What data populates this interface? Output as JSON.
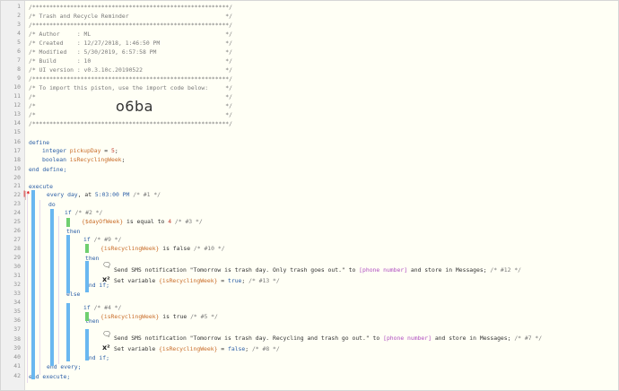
{
  "lines": [
    {
      "n": "1",
      "t": "/*********************************************************/",
      "c": "cmt"
    },
    {
      "n": "2",
      "t": "/* Trash and Recycle Reminder                            */",
      "c": "cmt"
    },
    {
      "n": "3",
      "t": "/*********************************************************/",
      "c": "cmt"
    },
    {
      "n": "4",
      "t": "/* Author     : ML                                       */",
      "c": "cmt"
    },
    {
      "n": "5",
      "t": "/* Created    : 12/27/2018, 1:46:50 PM                   */",
      "c": "cmt"
    },
    {
      "n": "6",
      "t": "/* Modified   : 5/30/2019, 6:57:58 PM                    */",
      "c": "cmt"
    },
    {
      "n": "7",
      "t": "/* Build      : 10                                       */",
      "c": "cmt"
    },
    {
      "n": "8",
      "t": "/* UI version : v0.3.10c.20190522                        */",
      "c": "cmt"
    },
    {
      "n": "9",
      "t": "/*********************************************************/",
      "c": "cmt"
    },
    {
      "n": "10",
      "t": "/* To import this piston, use the import code below:     */",
      "c": "cmt"
    },
    {
      "n": "11",
      "t": "/*                                                       */",
      "c": "cmt"
    },
    {
      "n": "12",
      "t": "/*                                                       */",
      "c": "cmt"
    },
    {
      "n": "13",
      "t": "/*                                                       */",
      "c": "cmt"
    },
    {
      "n": "14",
      "t": "/*********************************************************/",
      "c": "cmt"
    },
    {
      "n": "15",
      "t": "",
      "c": ""
    },
    {
      "n": "16",
      "t": "define",
      "c": "kw"
    },
    {
      "n": "17",
      "t": "",
      "c": ""
    },
    {
      "n": "18",
      "t": "",
      "c": ""
    },
    {
      "n": "19",
      "t": "end define;",
      "c": "kw"
    },
    {
      "n": "20",
      "t": "",
      "c": ""
    },
    {
      "n": "21",
      "t": "execute",
      "c": "kw"
    },
    {
      "n": "22",
      "t": "",
      "c": ""
    },
    {
      "n": "23",
      "t": "do",
      "c": "kw"
    },
    {
      "n": "24",
      "t": "",
      "c": ""
    },
    {
      "n": "25",
      "t": "",
      "c": ""
    },
    {
      "n": "26",
      "t": "then",
      "c": "kw"
    },
    {
      "n": "27",
      "t": "",
      "c": ""
    },
    {
      "n": "28",
      "t": "",
      "c": ""
    },
    {
      "n": "29",
      "t": "then",
      "c": "kw"
    },
    {
      "n": "30",
      "t": "",
      "c": ""
    },
    {
      "n": "31",
      "t": "",
      "c": ""
    },
    {
      "n": "32",
      "t": "end if;",
      "c": "kw"
    },
    {
      "n": "33",
      "t": "else",
      "c": "kw"
    },
    {
      "n": "34",
      "t": "",
      "c": ""
    },
    {
      "n": "35",
      "t": "",
      "c": ""
    },
    {
      "n": "36",
      "t": "then",
      "c": "kw"
    },
    {
      "n": "37",
      "t": "",
      "c": ""
    },
    {
      "n": "38",
      "t": "",
      "c": ""
    },
    {
      "n": "39",
      "t": "",
      "c": ""
    },
    {
      "n": "40",
      "t": "end if;",
      "c": "kw"
    },
    {
      "n": "41",
      "t": "end every;",
      "c": "kw"
    },
    {
      "n": "42",
      "t": "end execute;",
      "c": "kw"
    }
  ],
  "import_code": "o6ba",
  "define": {
    "l17": {
      "type": "integer",
      "name": "pickupDay",
      "eq": " = ",
      "val": "5",
      "end": ";"
    },
    "l18": {
      "type": "boolean",
      "name": "isRecyclingWeek",
      "end": ";"
    }
  },
  "every": {
    "kw": "every",
    "day": "day",
    "at": ", at ",
    "time": "5:03:00 PM",
    "cmt": "/* #1 */"
  },
  "if1": {
    "kw": "if",
    "cmt": "/* #2 */",
    "var": "{$dayOfWeek}",
    "op": " is equal to ",
    "val": "4",
    "cmt2": "/* #3 */"
  },
  "if2": {
    "kw": "if",
    "cmt": "/* #9 */",
    "var": "{isRecyclingWeek}",
    "op": " is false",
    "cmt2": "/* #10 */"
  },
  "sms1": {
    "pre": "Send SMS notification \"Tomorrow is trash day. Only trash goes out.\" to ",
    "ph": "[phone number]",
    "post": " and store in Messages; ",
    "cmt": "/* #12 */"
  },
  "set1": {
    "pre": "Set variable ",
    "var": "{isRecyclingWeek}",
    "op": " = ",
    "val": "true",
    "end": "; ",
    "cmt": "/* #13 */"
  },
  "if3": {
    "kw": "if",
    "cmt": "/* #4 */",
    "var": "{isRecyclingWeek}",
    "op": " is true",
    "cmt2": "/* #5 */"
  },
  "sms2": {
    "pre": "Send SMS notification \"Tomorrow is trash day. Recycling and trash go out.\" to ",
    "ph": "[phone number]",
    "post": " and store in Messages; ",
    "cmt": "/* #7 */"
  },
  "set2": {
    "pre": "Set variable ",
    "var": "{isRecyclingWeek}",
    "op": " = ",
    "val": "false",
    "end": "; ",
    "cmt": "/* #8 */"
  },
  "icons": {
    "sms": "message-icon",
    "set": "variable-icon"
  }
}
